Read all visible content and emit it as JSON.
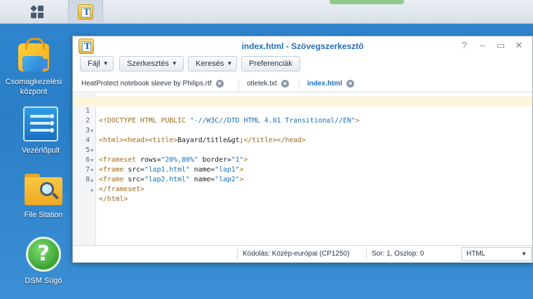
{
  "desktop": {
    "icons": [
      {
        "label": "Csomagkezelési\nközpont",
        "label_line1": "Csomagkezelési",
        "label_line2": "központ",
        "icon": "package-center-icon"
      },
      {
        "label": "Vezérlőpult",
        "icon": "control-panel-icon"
      },
      {
        "label": "File Station",
        "icon": "file-station-icon"
      },
      {
        "label": "DSM Súgó",
        "icon": "help-icon"
      }
    ]
  },
  "taskbar": {
    "main_menu_icon": "main-menu-icon",
    "running_app_icon": "text-editor-icon"
  },
  "window": {
    "title": "index.html - Szövegszerkesztő",
    "controls": {
      "help": "?",
      "minimize": "–",
      "maximize": "▭",
      "close": "✕"
    },
    "toolbar": {
      "file": "Fájl",
      "edit": "Szerkesztés",
      "search": "Keresés",
      "preferences": "Preferenciák"
    },
    "tabs": [
      {
        "label": "HeatProtect notebook sleeve by Philips.rtf",
        "active": false
      },
      {
        "label": "otletek.txt",
        "active": false
      },
      {
        "label": "index.html",
        "active": true
      }
    ],
    "editor": {
      "lines": [
        {
          "n": "1",
          "fold": false
        },
        {
          "n": "2",
          "fold": true
        },
        {
          "n": "3",
          "fold": false
        },
        {
          "n": "4",
          "fold": true
        },
        {
          "n": "5",
          "fold": true
        },
        {
          "n": "6",
          "fold": true
        },
        {
          "n": "7",
          "fold": true
        },
        {
          "n": "8",
          "fold": true
        }
      ],
      "code": {
        "l1_open": "<!DOCTYPE HTML PUBLIC ",
        "l1_str": "\"-//W3C//DTD HTML 4.01 Transitional//EN\"",
        "l1_close": ">",
        "l2_tags1": "<html><head><title>",
        "l2_text": "Bayard/title&gt;",
        "l2_tags2": "</title></head>",
        "l4_tag": "<frameset ",
        "l4_attr1": "rows=",
        "l4_val1": "\"20%,80%\"",
        "l4_attr2": " border=",
        "l4_val2": "\"1\"",
        "l4_close": ">",
        "l5_tag": "<frame ",
        "l5_attr1": "src=",
        "l5_val1": "\"lap1.html\"",
        "l5_attr2": " name=",
        "l5_val2": "\"lap1\"",
        "l5_close": ">",
        "l6_tag": "<frame ",
        "l6_attr1": "src=",
        "l6_val1": "\"lap2.html\"",
        "l6_attr2": " name=",
        "l6_val2": "\"lap2\"",
        "l6_close": ">",
        "l7": "</frameset>",
        "l8": "</html>"
      }
    },
    "status": {
      "encoding": "Kódolás: Közép-európai (CP1250)",
      "position": "Sor: 1, Oszlop: 0",
      "language": "HTML"
    }
  }
}
